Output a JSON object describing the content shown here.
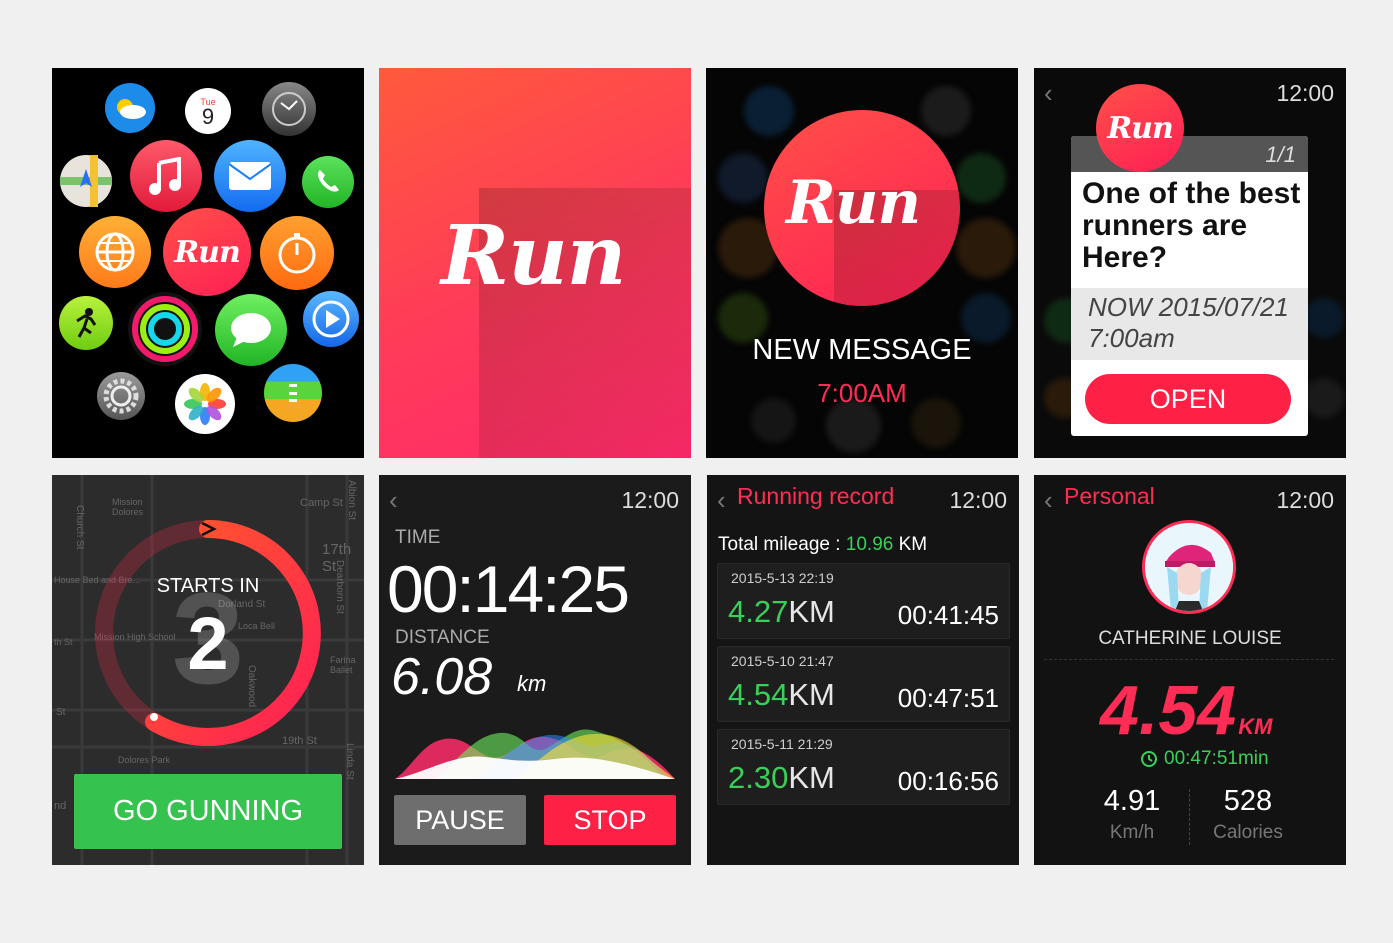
{
  "screen1": {
    "run_app_label": "Run",
    "calendar_day": "Tue",
    "calendar_date": "9"
  },
  "screen2": {
    "logo": "Run"
  },
  "screen3": {
    "logo": "Run",
    "message_title": "NEW MESSAGE",
    "message_time": "7:00AM"
  },
  "screen4": {
    "time": "12:00",
    "logo": "Run",
    "pager": "1/1",
    "headline": "One of the best runners are Here?",
    "timestamp_line1": "NOW 2015/07/21",
    "timestamp_line2": "7:00am",
    "open_label": "OPEN"
  },
  "screen5": {
    "starts_in": "STARTS IN",
    "back_count": "3",
    "count": "2",
    "go_label": "GO GUNNING",
    "map_labels": [
      "Mission Dolores",
      "Camp St",
      "17th St",
      "Church St",
      "House Bed and Bre...",
      "Dearborn St",
      "Mission High School",
      "Dolores Park",
      "19th St",
      "Linda St",
      "Oakwood",
      "nd",
      "Albion St",
      "Dorland St",
      "th St",
      "St",
      "Farina Ballet",
      "Loca Bell"
    ]
  },
  "screen6": {
    "time": "12:00",
    "time_label": "TIME",
    "time_value": "00:14:25",
    "distance_label": "DISTANCE",
    "distance_value": "6.08",
    "distance_unit": "km",
    "pause_label": "PAUSE",
    "stop_label": "STOP"
  },
  "screen7": {
    "title": "Running record",
    "time": "12:00",
    "total_label": "Total mileage : ",
    "total_value": "10.96",
    "total_unit": " KM",
    "records": [
      {
        "date": "2015-5-13 22:19",
        "km": "4.27",
        "unit": "KM",
        "duration": "00:41:45"
      },
      {
        "date": "2015-5-10 21:47",
        "km": "4.54",
        "unit": "KM",
        "duration": "00:47:51"
      },
      {
        "date": "2015-5-11 21:29",
        "km": "2.30",
        "unit": "KM",
        "duration": "00:16:56"
      }
    ]
  },
  "screen8": {
    "title": "Personal",
    "time": "12:00",
    "name": "CATHERINE LOUISE",
    "distance": "4.54",
    "distance_unit": "KM",
    "duration": "00:47:51min",
    "speed_value": "4.91",
    "speed_unit": "Km/h",
    "calories_value": "528",
    "calories_unit": "Calories"
  }
}
